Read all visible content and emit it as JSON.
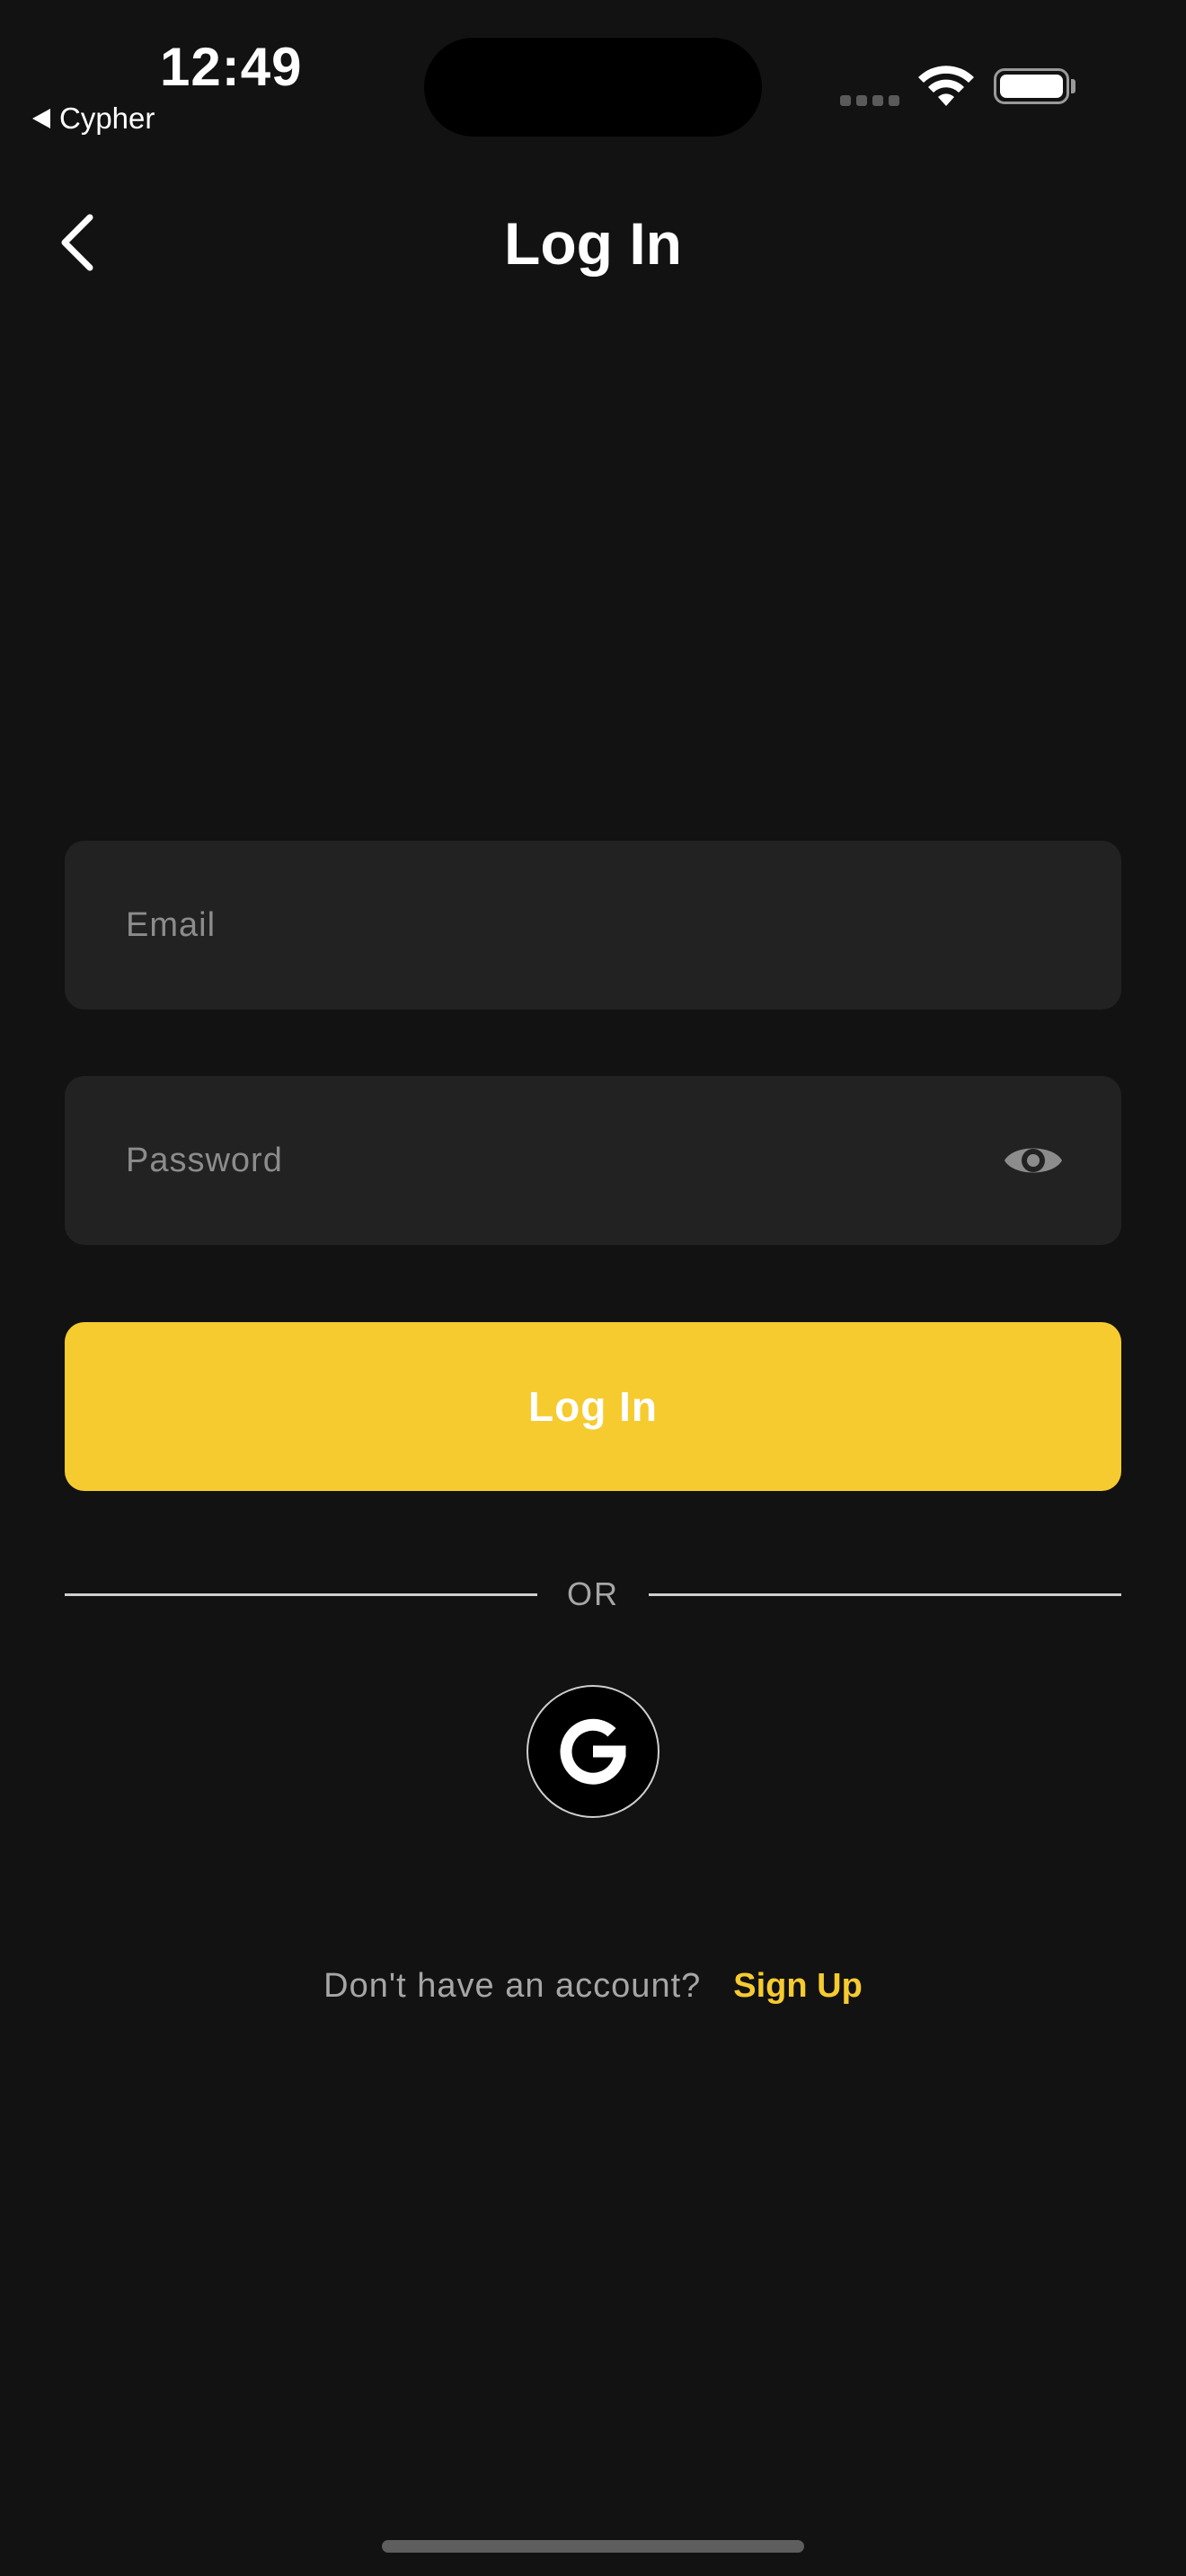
{
  "status_bar": {
    "time": "12:49",
    "back_app_label": "Cypher"
  },
  "header": {
    "title": "Log In",
    "back_icon": "chevron-left-icon"
  },
  "form": {
    "email_placeholder": "Email",
    "email_value": "",
    "password_placeholder": "Password",
    "password_value": "",
    "password_toggle_icon": "eye-icon",
    "login_button_label": "Log In"
  },
  "divider": {
    "label": "OR"
  },
  "social": {
    "google_icon": "google-icon"
  },
  "footer": {
    "prompt": "Don't have an account?",
    "signup_link": "Sign Up"
  },
  "colors": {
    "background": "#121212",
    "field_background": "#222222",
    "accent": "#f6cb30",
    "muted_text": "#a6a6a6"
  }
}
